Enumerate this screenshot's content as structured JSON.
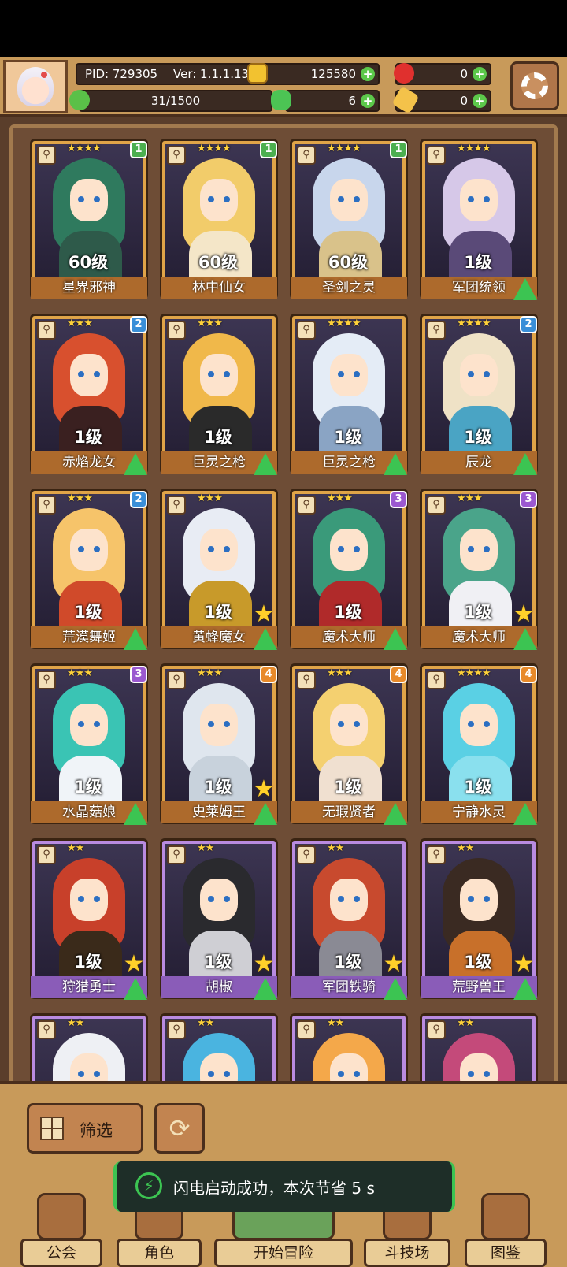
{
  "header": {
    "pid": "PID: 729305",
    "version": "Ver: 1.1.1.13",
    "gold": "125580",
    "gems": "0",
    "energy": "31/1500",
    "clovers": "6",
    "pies": "0"
  },
  "icons": {
    "avatar": "player-avatar",
    "gold": "gold-coin-icon",
    "gem": "red-apple-icon",
    "energy": "green-gem-icon",
    "clover": "clover-icon",
    "pie": "bread-icon",
    "settings": "gear-icon"
  },
  "colors": {
    "gold_frame": "#e0a448",
    "purple_frame": "#b98be0",
    "upgrade_green": "#3cc452",
    "badge_green": "#4caf50",
    "badge_blue": "#3a8fd8",
    "badge_purple": "#9b59d0",
    "badge_orange": "#e88a2a"
  },
  "heroes": [
    {
      "name": "星界邪神",
      "level": "60级",
      "stars": "★★★★",
      "badge": "1",
      "badge_color": "#4caf50",
      "frame": "gold",
      "hair": "#2f7a5e",
      "body": "#2e5a4a",
      "upgrade": false,
      "star_badge": false
    },
    {
      "name": "林中仙女",
      "level": "60级",
      "stars": "★★★★",
      "badge": "1",
      "badge_color": "#4caf50",
      "frame": "gold",
      "hair": "#f2cc6a",
      "body": "#f4e6c8",
      "upgrade": false,
      "star_badge": false
    },
    {
      "name": "圣剑之灵",
      "level": "60级",
      "stars": "★★★★",
      "badge": "1",
      "badge_color": "#4caf50",
      "frame": "gold",
      "hair": "#c8d6ec",
      "body": "#d9c28a",
      "upgrade": false,
      "star_badge": false
    },
    {
      "name": "军团统领",
      "level": "1级",
      "stars": "★★★★",
      "badge": "",
      "badge_color": "",
      "frame": "gold",
      "hair": "#d6c8e8",
      "body": "#5a4a78",
      "upgrade": true,
      "star_badge": false
    },
    {
      "name": "赤焰龙女",
      "level": "1级",
      "stars": "★★★",
      "badge": "2",
      "badge_color": "#3a8fd8",
      "frame": "gold",
      "hair": "#d8502e",
      "body": "#3a2020",
      "upgrade": true,
      "star_badge": false
    },
    {
      "name": "巨灵之枪",
      "level": "1级",
      "stars": "★★★",
      "badge": "",
      "badge_color": "",
      "frame": "gold",
      "hair": "#f0b84a",
      "body": "#2a2a2a",
      "upgrade": true,
      "star_badge": false
    },
    {
      "name": "巨灵之枪",
      "level": "1级",
      "stars": "★★★★",
      "badge": "",
      "badge_color": "",
      "frame": "gold",
      "hair": "#e4ecf6",
      "body": "#8aa4c4",
      "upgrade": true,
      "star_badge": false
    },
    {
      "name": "辰龙",
      "level": "1级",
      "stars": "★★★★",
      "badge": "2",
      "badge_color": "#3a8fd8",
      "frame": "gold",
      "hair": "#efe2c6",
      "body": "#4aa4c4",
      "upgrade": true,
      "star_badge": false
    },
    {
      "name": "荒漠舞姬",
      "level": "1级",
      "stars": "★★★",
      "badge": "2",
      "badge_color": "#3a8fd8",
      "frame": "gold",
      "hair": "#f6c46a",
      "body": "#d04a2a",
      "upgrade": true,
      "star_badge": false
    },
    {
      "name": "黄蜂魔女",
      "level": "1级",
      "stars": "★★★",
      "badge": "",
      "badge_color": "",
      "frame": "gold",
      "hair": "#e8ecf4",
      "body": "#c89a2a",
      "upgrade": true,
      "star_badge": true
    },
    {
      "name": "魔术大师",
      "level": "1级",
      "stars": "★★★",
      "badge": "3",
      "badge_color": "#9b59d0",
      "frame": "gold",
      "hair": "#3a9a7a",
      "body": "#b02a2a",
      "upgrade": true,
      "star_badge": false
    },
    {
      "name": "魔术大师",
      "level": "1级",
      "stars": "★★★",
      "badge": "3",
      "badge_color": "#9b59d0",
      "frame": "gold",
      "hair": "#4aa48a",
      "body": "#f0f0f4",
      "upgrade": true,
      "star_badge": true
    },
    {
      "name": "水晶菇娘",
      "level": "1级",
      "stars": "★★★",
      "badge": "3",
      "badge_color": "#9b59d0",
      "frame": "gold",
      "hair": "#3ac4b4",
      "body": "#f0f4f8",
      "upgrade": true,
      "star_badge": false
    },
    {
      "name": "史莱姆王",
      "level": "1级",
      "stars": "★★★",
      "badge": "4",
      "badge_color": "#e88a2a",
      "frame": "gold",
      "hair": "#dfe6ee",
      "body": "#c8d2dc",
      "upgrade": true,
      "star_badge": true
    },
    {
      "name": "无瑕贤者",
      "level": "1级",
      "stars": "★★★",
      "badge": "4",
      "badge_color": "#e88a2a",
      "frame": "gold",
      "hair": "#f4d070",
      "body": "#f0e0d0",
      "upgrade": true,
      "star_badge": false
    },
    {
      "name": "宁静水灵",
      "level": "1级",
      "stars": "★★★★",
      "badge": "4",
      "badge_color": "#e88a2a",
      "frame": "gold",
      "hair": "#5ad0e4",
      "body": "#8ae0ee",
      "upgrade": true,
      "star_badge": false
    },
    {
      "name": "狩猎勇士",
      "level": "1级",
      "stars": "★★",
      "badge": "",
      "badge_color": "",
      "frame": "purple",
      "hair": "#c8402a",
      "body": "#3a2a1a",
      "upgrade": true,
      "star_badge": true
    },
    {
      "name": "胡椒",
      "level": "1级",
      "stars": "★★",
      "badge": "",
      "badge_color": "",
      "frame": "purple",
      "hair": "#2a2a2e",
      "body": "#cfcfd4",
      "upgrade": true,
      "star_badge": true
    },
    {
      "name": "军团铁骑",
      "level": "1级",
      "stars": "★★",
      "badge": "",
      "badge_color": "",
      "frame": "purple",
      "hair": "#c84a2e",
      "body": "#8a8a94",
      "upgrade": true,
      "star_badge": true
    },
    {
      "name": "荒野兽王",
      "level": "1级",
      "stars": "★★",
      "badge": "",
      "badge_color": "",
      "frame": "purple",
      "hair": "#3a2a22",
      "body": "#c8702a",
      "upgrade": true,
      "star_badge": true
    },
    {
      "name": "",
      "level": "",
      "stars": "★★",
      "badge": "",
      "badge_color": "",
      "frame": "purple",
      "hair": "#eef0f4",
      "body": "#6a6a74",
      "upgrade": false,
      "star_badge": false
    },
    {
      "name": "",
      "level": "",
      "stars": "★★",
      "badge": "",
      "badge_color": "",
      "frame": "purple",
      "hair": "#4ab4e0",
      "body": "#4ab4e0",
      "upgrade": false,
      "star_badge": false
    },
    {
      "name": "",
      "level": "",
      "stars": "★★",
      "badge": "",
      "badge_color": "",
      "frame": "purple",
      "hair": "#f4a84a",
      "body": "#f4a84a",
      "upgrade": false,
      "star_badge": false
    },
    {
      "name": "",
      "level": "",
      "stars": "★★",
      "badge": "",
      "badge_color": "",
      "frame": "purple",
      "hair": "#c44a7a",
      "body": "#c44a7a",
      "upgrade": false,
      "star_badge": false
    }
  ],
  "actions": {
    "filter_label": "筛选",
    "refresh_symbol": "⟳"
  },
  "toast": {
    "bolt_symbol": "⚡",
    "message": "闪电启动成功，本次节省 5 s"
  },
  "nav": [
    {
      "label": "公会",
      "icon": "guild-house-icon"
    },
    {
      "label": "角色",
      "icon": "character-icon"
    },
    {
      "label": "开始冒险",
      "icon": "adventure-map-icon"
    },
    {
      "label": "斗技场",
      "icon": "crossed-swords-icon"
    },
    {
      "label": "图鉴",
      "icon": "book-icon"
    }
  ]
}
